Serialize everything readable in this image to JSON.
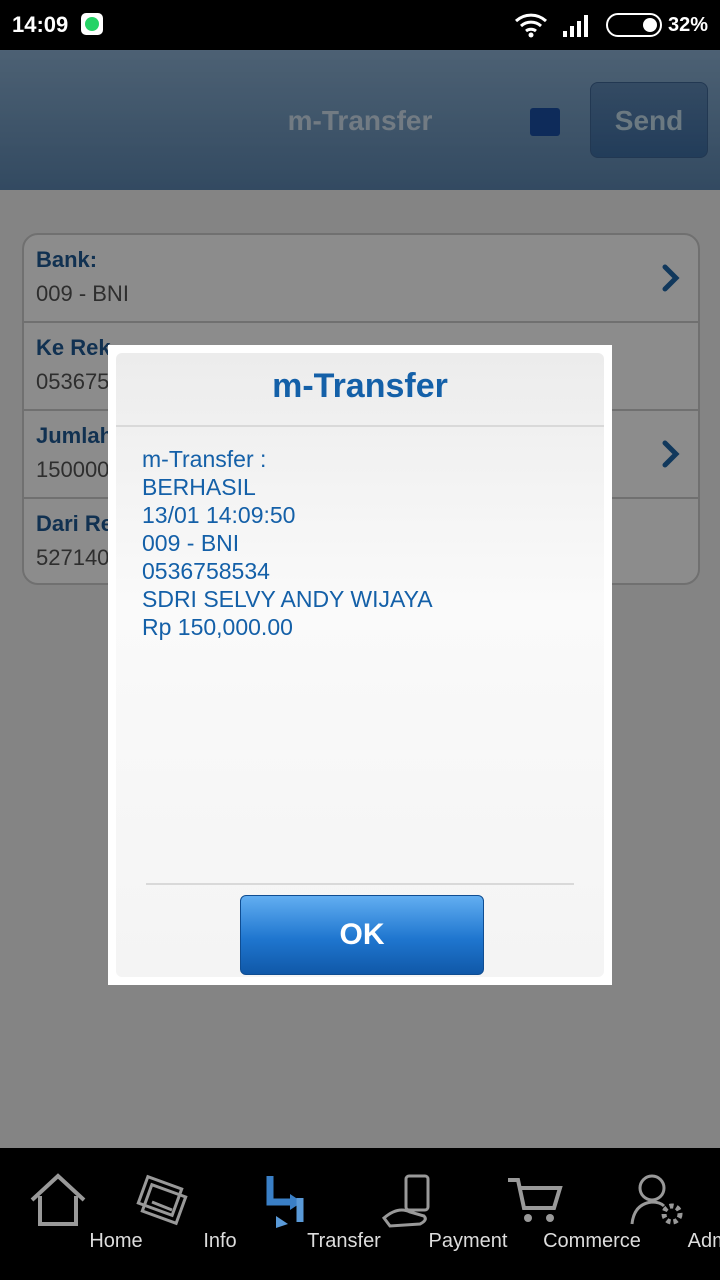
{
  "status_bar": {
    "time": "14:09",
    "battery": "32%",
    "icons": [
      "whatsapp-icon",
      "wifi-icon",
      "signal-icon",
      "battery-icon"
    ]
  },
  "header": {
    "title": "m-Transfer",
    "send_label": "Send"
  },
  "form": {
    "rows": [
      {
        "label": "Bank:",
        "value": "009 - BNI"
      },
      {
        "label": "Ke Rek",
        "value": "053675"
      },
      {
        "label": "Jumlah",
        "value": "150000"
      },
      {
        "label": "Dari Re",
        "value": "527140"
      }
    ]
  },
  "dialog": {
    "title": "m-Transfer",
    "lines": [
      "m-Transfer :",
      "BERHASIL",
      "13/01 14:09:50",
      "009 - BNI",
      "0536758534",
      "SDRI SELVY ANDY WIJAYA",
      "Rp 150,000.00"
    ],
    "ok_label": "OK"
  },
  "nav": {
    "items": [
      {
        "label": "Home",
        "icon": "home-icon"
      },
      {
        "label": "Info",
        "icon": "info-icon"
      },
      {
        "label": "Transfer",
        "icon": "transfer-icon"
      },
      {
        "label": "Payment",
        "icon": "payment-icon"
      },
      {
        "label": "Commerce",
        "icon": "cart-icon"
      },
      {
        "label": "Admin",
        "icon": "admin-icon"
      }
    ]
  },
  "colors": {
    "header": "#5d87b1",
    "accent": "#1460a8",
    "ok_button": "#1f76cf"
  }
}
